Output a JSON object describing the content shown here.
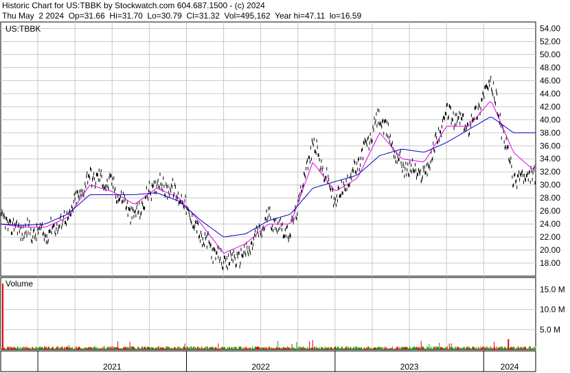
{
  "header": {
    "line1": "Historic Chart for US:TBBK by Stockwatch.com 604.687.1500 - (c) 2024",
    "line2": "Thu May  2 2024  Op=31.66  Hi=31.70  Lo=30.79  Cl=31.32  Vol=495,162  Year hi=47.11  lo=16.59"
  },
  "colors": {
    "price": "#000000",
    "ma_short": "#e000e0",
    "ma_long": "#0000c0",
    "grid": "#c8c8c8",
    "volume_up": "#00a000",
    "volume_down": "#e00000"
  },
  "chart_data": [
    {
      "type": "line",
      "title": "US:TBBK",
      "ylim": [
        16,
        55
      ],
      "y_ticks": [
        "54.00",
        "52.00",
        "50.00",
        "48.00",
        "46.00",
        "44.00",
        "42.00",
        "40.00",
        "38.00",
        "36.00",
        "34.00",
        "32.00",
        "30.00",
        "28.00",
        "26.00",
        "24.00",
        "22.00",
        "20.00",
        "18.00"
      ],
      "y_tick_values": [
        54,
        52,
        50,
        48,
        46,
        44,
        42,
        40,
        38,
        36,
        34,
        32,
        30,
        28,
        26,
        24,
        22,
        20,
        18
      ],
      "x": [
        "2021-01",
        "2021-03",
        "2021-05",
        "2021-07",
        "2021-09",
        "2021-11",
        "2022-01",
        "2022-03",
        "2022-05",
        "2022-07",
        "2022-09",
        "2022-11",
        "2023-01",
        "2023-03",
        "2023-05",
        "2023-07",
        "2023-09",
        "2023-11",
        "2024-01",
        "2024-03",
        "2024-05"
      ],
      "series": [
        {
          "values": [
            24.5,
            23.0,
            22.5,
            25.0,
            31.5,
            30.0,
            25.0,
            30.5,
            28.5,
            22.0,
            18.0,
            19.5,
            25.0,
            22.5,
            36.5,
            27.5,
            33.0,
            40.5,
            33.0,
            31.5,
            41.0,
            39.0,
            46.0,
            31.0,
            31.3
          ]
        },
        {
          "values": [
            24.0,
            23.5,
            23.5,
            25.0,
            30.0,
            29.0,
            27.0,
            29.5,
            28.0,
            24.0,
            19.5,
            21.0,
            24.0,
            24.0,
            33.5,
            29.0,
            31.0,
            38.0,
            34.0,
            33.5,
            39.0,
            39.0,
            43.0,
            35.0,
            32.0
          ]
        },
        {
          "values": [
            24.0,
            23.8,
            24.0,
            25.5,
            28.5,
            28.5,
            28.5,
            28.8,
            27.5,
            24.5,
            22.0,
            22.5,
            24.5,
            25.5,
            29.5,
            30.5,
            31.5,
            34.5,
            35.5,
            35.0,
            36.5,
            38.5,
            40.5,
            38.0,
            38.0
          ]
        }
      ],
      "x_ticks": [
        "2021",
        "2022",
        "2023",
        "2024"
      ]
    },
    {
      "type": "bar",
      "title": "Volume",
      "ylim": [
        0,
        18000000
      ],
      "y_ticks": [
        "15.0 M",
        "10.0 M",
        "5.0 M"
      ],
      "y_tick_values": [
        15000000,
        10000000,
        5000000
      ],
      "spikes": [
        {
          "x": "2021-01",
          "value": 16500000
        },
        {
          "x": "2024-03",
          "value": 2600000
        }
      ],
      "typical_value": 500000
    }
  ]
}
